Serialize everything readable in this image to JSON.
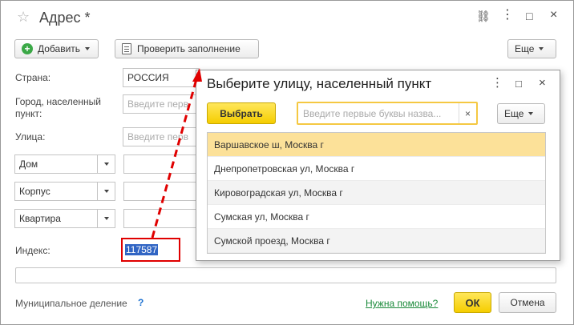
{
  "window": {
    "title": "Адрес *",
    "controls": {
      "link": "🔗",
      "menu": "⋮",
      "maximize": "□",
      "close": "×"
    }
  },
  "toolbar": {
    "add_label": "Добавить",
    "check_label": "Проверить заполнение",
    "more_label": "Еще"
  },
  "form": {
    "country_label": "Страна:",
    "country_value": "РОССИЯ",
    "city_label": "Город, населенный пункт:",
    "city_placeholder": "Введите перв",
    "street_label": "Улица:",
    "street_placeholder": "Введите перв",
    "house_select": "Дом",
    "building_select": "Корпус",
    "apartment_select": "Квартира",
    "index_label": "Индекс:",
    "index_value": "117587"
  },
  "footer": {
    "municipal_label": "Муниципальное деление",
    "help_mark": "?",
    "help_link": "Нужна помощь?",
    "ok_label": "ОК",
    "cancel_label": "Отмена"
  },
  "popup": {
    "title": "Выберите улицу, населенный пункт",
    "select_label": "Выбрать",
    "search_placeholder": "Введите первые буквы назва...",
    "clear": "×",
    "more_label": "Еще",
    "items": [
      "Варшавское ш, Москва г",
      "Днепропетровская ул, Москва г",
      "Кировоградская ул, Москва г",
      "Сумская ул, Москва г",
      "Сумской проезд, Москва г"
    ]
  },
  "colors": {
    "accent_yellow": "#f5cd00",
    "selected_row": "#fce199",
    "highlight_red": "#e00000",
    "help_green": "#1a8a3a",
    "text_selection": "#3165c4"
  }
}
